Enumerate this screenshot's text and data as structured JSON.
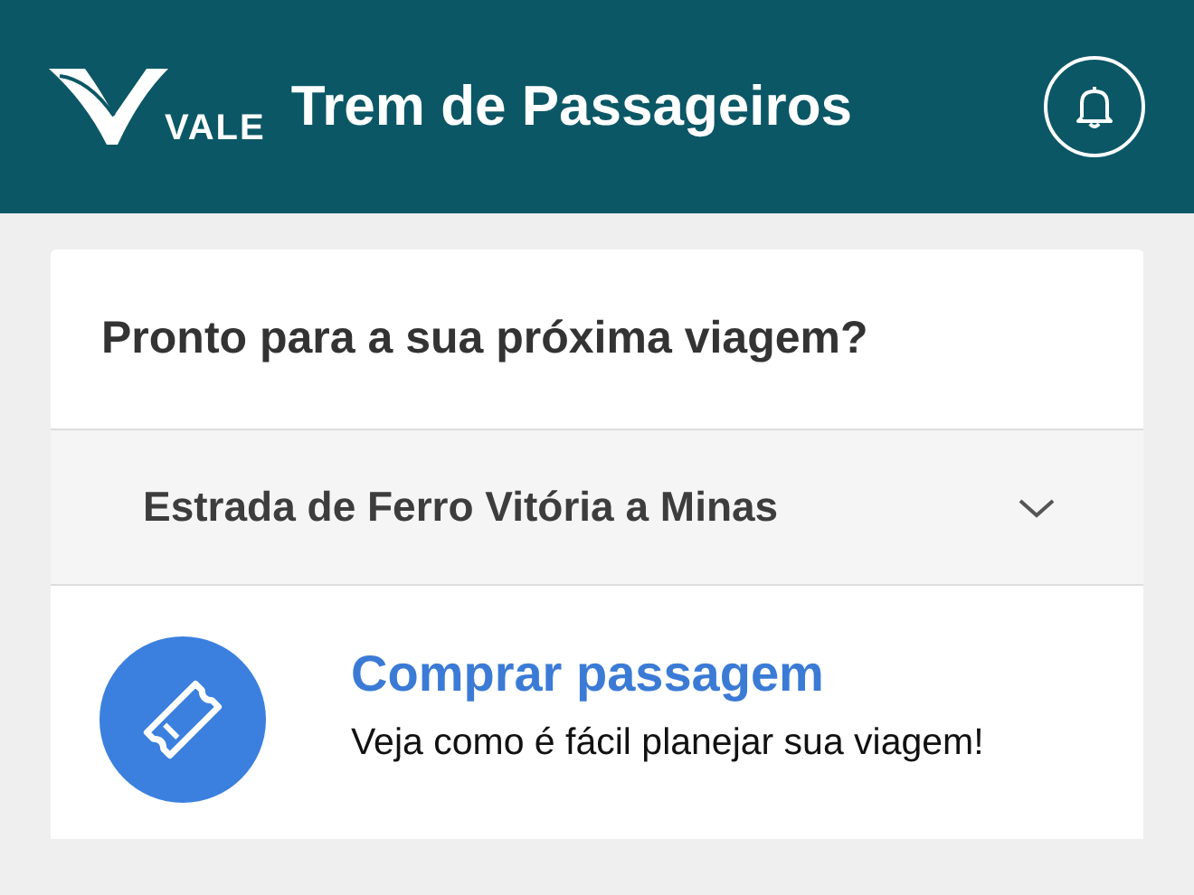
{
  "header": {
    "brand": "VALE",
    "title": "Trem de Passageiros"
  },
  "card": {
    "heading": "Pronto para a sua próxima viagem?",
    "railway_select": {
      "value": "Estrada de Ferro Vitória a Minas"
    },
    "actions": [
      {
        "title": "Comprar passagem",
        "description": "Veja como é fácil planejar sua viagem!"
      }
    ]
  }
}
